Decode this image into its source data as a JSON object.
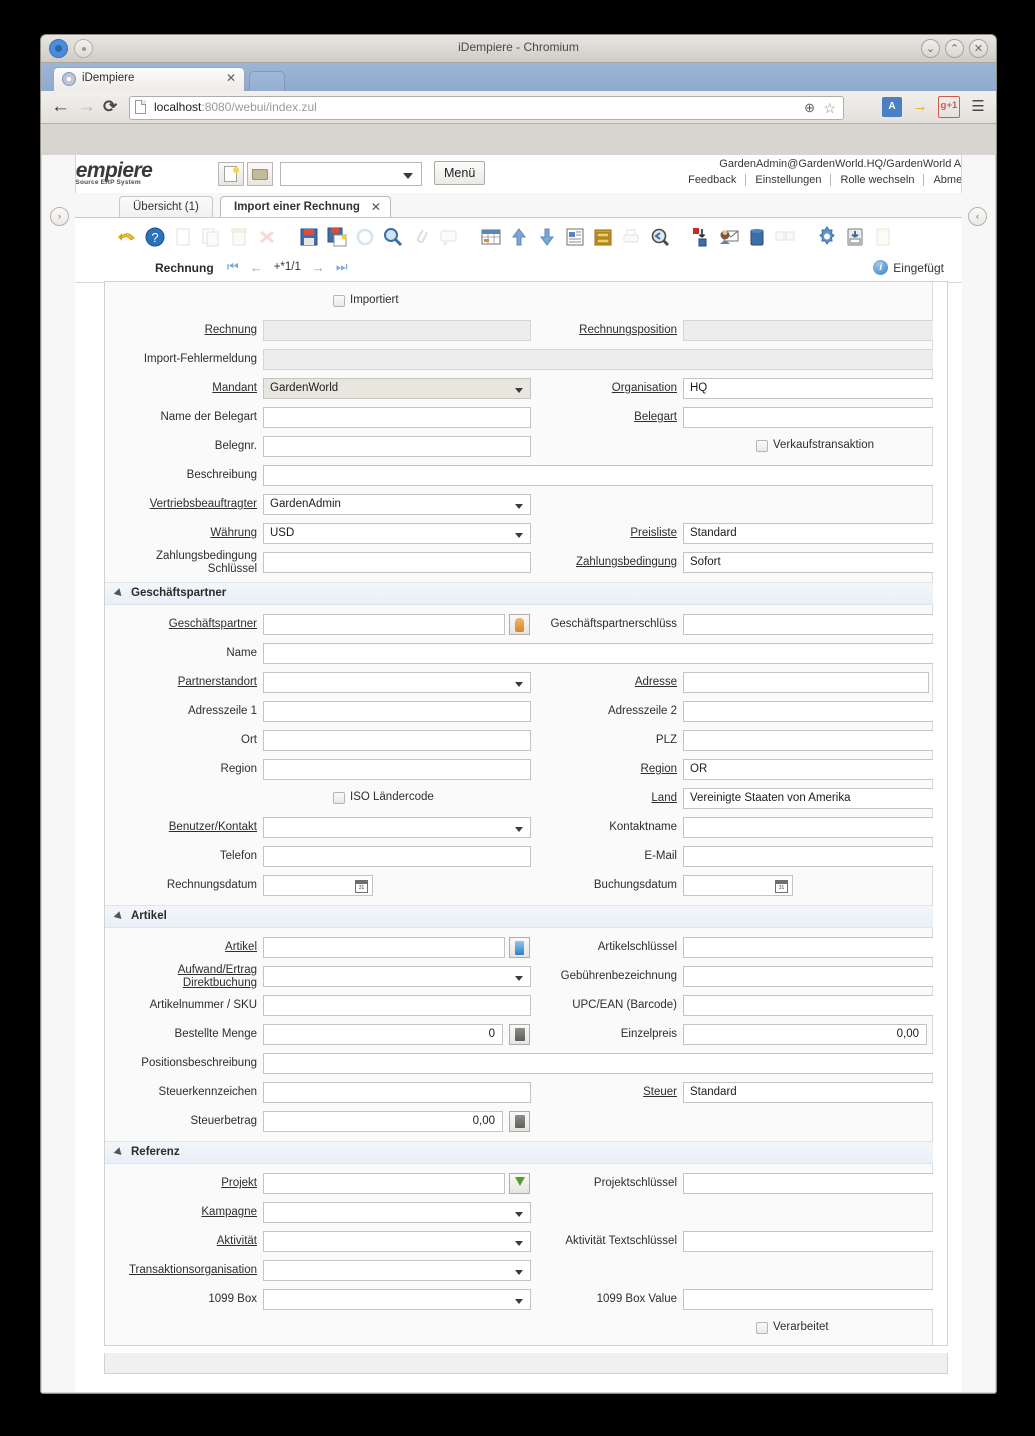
{
  "window": {
    "title": "iDempiere - Chromium",
    "minimize": "⌄",
    "maximize": "⌃",
    "close": "✕"
  },
  "browser": {
    "tab_title": "iDempiere",
    "tab_close": "✕",
    "back_icon": "←",
    "forward_icon": "→",
    "reload_icon": "⟳",
    "url_host": "localhost",
    "url_rest": ":8080/webui/index.zul",
    "zoom_icon": "⊕",
    "star_icon": "☆",
    "translate_icon": "A",
    "phone_icon": "→",
    "gplus_icon": "g+1",
    "menu_icon": "☰"
  },
  "app": {
    "brand_main": "iDempiere",
    "brand_sub": "Open Source ERP System",
    "search_value": "",
    "menu_label": "Menü",
    "user": "GardenAdmin@GardenWorld.HQ/GardenWorld Admin",
    "links": [
      "Feedback",
      "Einstellungen",
      "Rolle wechseln",
      "Abmelden"
    ],
    "left_toggle": "›",
    "right_toggle": "‹"
  },
  "window_tabs": [
    {
      "label": "Übersicht (1)",
      "active": false
    },
    {
      "label": "Import einer Rechnung",
      "active": true,
      "close": "✕"
    }
  ],
  "toolbar_icons": [
    "undo-icon",
    "help-icon",
    "new-record-icon",
    "copy-record-icon",
    "delete-record-icon",
    "delete-selection-icon",
    "save-icon",
    "save-create-new-icon",
    "refresh-icon",
    "find-icon",
    "attachment-icon",
    "chat-icon",
    "grid-toggle-icon",
    "parent-record-icon",
    "detail-record-icon",
    "report-icon",
    "archive-icon",
    "print-icon",
    "zoom-across-icon",
    "active-workflow-icon",
    "request-icon",
    "product-info-icon",
    "csv-import-icon",
    "preference-icon",
    "process-icon",
    "export-icon"
  ],
  "record_nav": {
    "label": "Rechnung",
    "first_icon": "⏮",
    "prev_icon": "←",
    "position": "+*1/1",
    "next_icon": "→",
    "last_icon": "⏭",
    "status": "Eingefügt",
    "status_icon": "i"
  },
  "form": {
    "top": {
      "imported_label": "Importiert",
      "imported_checked": false,
      "rows": [
        {
          "left_label": "Rechnung",
          "left_link": true,
          "left_type": "readonly",
          "left_value": "",
          "right_label": "Rechnungsposition",
          "right_link": true,
          "right_type": "readonly",
          "right_value": ""
        },
        {
          "left_label": "Import-Fehlermeldung",
          "left_link": false,
          "left_type": "readonly-wide",
          "left_value": ""
        },
        {
          "left_label": "Mandant",
          "left_link": true,
          "left_type": "select-mandatory",
          "left_value": "GardenWorld",
          "right_label": "Organisation",
          "right_link": true,
          "right_type": "select",
          "right_value": "HQ"
        },
        {
          "left_label": "Name der Belegart",
          "left_link": false,
          "left_type": "text",
          "left_value": "",
          "right_label": "Belegart",
          "right_link": true,
          "right_type": "select",
          "right_value": ""
        },
        {
          "left_label": "Belegnr.",
          "left_link": false,
          "left_type": "text",
          "left_value": "",
          "right_label": "Verkaufstransaktion",
          "right_type": "checkbox",
          "right_checked": false
        },
        {
          "left_label": "Beschreibung",
          "left_link": false,
          "left_type": "text-wide",
          "left_value": ""
        },
        {
          "left_label": "Vertriebsbeauftragter",
          "left_link": true,
          "left_type": "select",
          "left_value": "GardenAdmin"
        },
        {
          "left_label": "Währung",
          "left_link": true,
          "left_type": "select",
          "left_value": "USD",
          "right_label": "Preisliste",
          "right_link": true,
          "right_type": "select",
          "right_value": "Standard"
        },
        {
          "left_label": "Zahlungsbedingung Schlüssel",
          "left_link": false,
          "left_type": "text",
          "left_value": "",
          "left_two_line": true,
          "right_label": "Zahlungsbedingung",
          "right_link": true,
          "right_type": "select",
          "right_value": "Sofort"
        }
      ]
    },
    "groups": [
      {
        "title": "Geschäftspartner",
        "rows": [
          {
            "left_label": "Geschäftspartner",
            "left_link": true,
            "left_type": "text-button",
            "left_value": "",
            "left_button": "person-icon",
            "right_label": "Geschäftspartnerschlüss",
            "right_link": false,
            "right_type": "text",
            "right_value": ""
          },
          {
            "left_label": "Name",
            "left_link": false,
            "left_type": "text-wide",
            "left_value": ""
          },
          {
            "left_label": "Partnerstandort",
            "left_link": true,
            "left_type": "select",
            "left_value": "",
            "right_label": "Adresse",
            "right_link": true,
            "right_type": "text-button",
            "right_value": "",
            "right_button": "green-arrow-icon"
          },
          {
            "left_label": "Adresszeile 1",
            "left_link": false,
            "left_type": "text",
            "left_value": "",
            "right_label": "Adresszeile 2",
            "right_link": false,
            "right_type": "text",
            "right_value": ""
          },
          {
            "left_label": "Ort",
            "left_link": false,
            "left_type": "text",
            "left_value": "",
            "right_label": "PLZ",
            "right_link": false,
            "right_type": "text",
            "right_value": ""
          },
          {
            "left_label": "Region",
            "left_link": false,
            "left_type": "text",
            "left_value": "",
            "right_label": "Region",
            "right_link": true,
            "right_type": "select",
            "right_value": "OR"
          },
          {
            "left_label": "ISO Ländercode",
            "left_type": "checkbox",
            "left_checked": false,
            "right_label": "Land",
            "right_link": true,
            "right_type": "select",
            "right_value": "Vereinigte Staaten von Amerika"
          },
          {
            "left_label": "Benutzer/Kontakt",
            "left_link": true,
            "left_type": "select",
            "left_value": "",
            "right_label": "Kontaktname",
            "right_link": false,
            "right_type": "text",
            "right_value": ""
          },
          {
            "left_label": "Telefon",
            "left_link": false,
            "left_type": "text",
            "left_value": "",
            "right_label": "E-Mail",
            "right_link": false,
            "right_type": "text",
            "right_value": ""
          },
          {
            "left_label": "Rechnungsdatum",
            "left_link": false,
            "left_type": "date",
            "left_value": "",
            "right_label": "Buchungsdatum",
            "right_link": false,
            "right_type": "date",
            "right_value": ""
          }
        ]
      },
      {
        "title": "Artikel",
        "rows": [
          {
            "left_label": "Artikel",
            "left_link": true,
            "left_type": "text-button",
            "left_value": "",
            "left_button": "product-icon",
            "right_label": "Artikelschlüssel",
            "right_link": false,
            "right_type": "text",
            "right_value": ""
          },
          {
            "left_label": "Aufwand/Ertrag Direktbuchung",
            "left_link": true,
            "left_type": "select",
            "left_value": "",
            "left_two_line": true,
            "right_label": "Gebührenbezeichnung",
            "right_link": false,
            "right_type": "text",
            "right_value": ""
          },
          {
            "left_label": "Artikelnummer / SKU",
            "left_link": false,
            "left_type": "text",
            "left_value": "",
            "right_label": "UPC/EAN (Barcode)",
            "right_link": false,
            "right_type": "text",
            "right_value": ""
          },
          {
            "left_label": "Bestellte Menge",
            "left_link": false,
            "left_type": "number",
            "left_value": "0",
            "left_button": "calculator-icon",
            "right_label": "Einzelpreis",
            "right_link": false,
            "right_type": "number",
            "right_value": "0,00",
            "right_button": "calculator-icon"
          },
          {
            "left_label": "Positionsbeschreibung",
            "left_link": false,
            "left_type": "text-wide",
            "left_value": ""
          },
          {
            "left_label": "Steuerkennzeichen",
            "left_link": false,
            "left_type": "text",
            "left_value": "",
            "right_label": "Steuer",
            "right_link": true,
            "right_type": "select",
            "right_value": "Standard"
          },
          {
            "left_label": "Steuerbetrag",
            "left_link": false,
            "left_type": "number",
            "left_value": "0,00",
            "left_button": "calculator-icon"
          }
        ]
      },
      {
        "title": "Referenz",
        "rows": [
          {
            "left_label": "Projekt",
            "left_link": true,
            "left_type": "text-button",
            "left_value": "",
            "left_button": "green-arrow-icon",
            "right_label": "Projektschlüssel",
            "right_link": false,
            "right_type": "text",
            "right_value": ""
          },
          {
            "left_label": "Kampagne",
            "left_link": true,
            "left_type": "select",
            "left_value": ""
          },
          {
            "left_label": "Aktivität",
            "left_link": true,
            "left_type": "select",
            "left_value": "",
            "right_label": "Aktivität Textschlüssel",
            "right_link": false,
            "right_type": "text",
            "right_value": ""
          },
          {
            "left_label": "Transaktionsorganisation",
            "left_link": true,
            "left_type": "select",
            "left_value": "",
            "left_clip": true
          },
          {
            "left_label": "1099 Box",
            "left_link": false,
            "left_type": "select",
            "left_value": "",
            "right_label": "1099 Box Value",
            "right_link": false,
            "right_type": "text",
            "right_value": ""
          },
          {
            "right_label": "Verarbeitet",
            "right_type": "checkbox",
            "right_checked": false
          }
        ]
      }
    ]
  }
}
